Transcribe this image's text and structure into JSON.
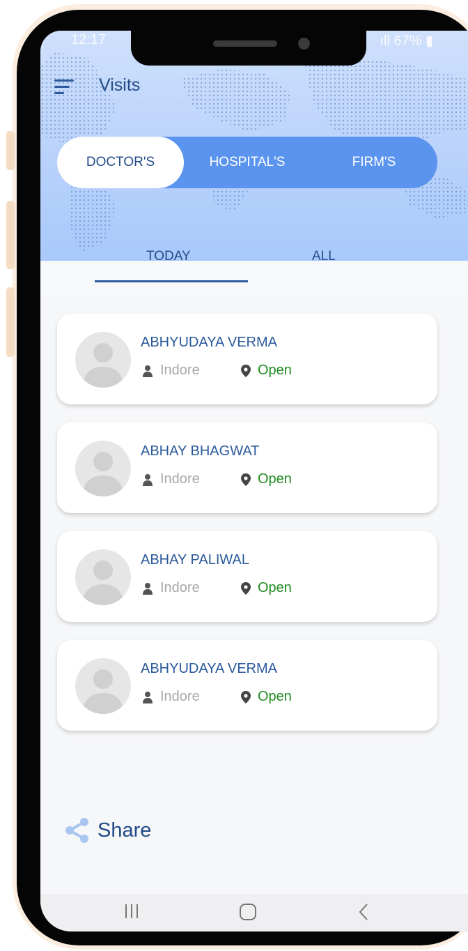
{
  "status_bar": {
    "time": "12:17",
    "battery": "67%"
  },
  "header": {
    "title": "Visits"
  },
  "segments": [
    {
      "label": "DOCTOR'S",
      "active": true
    },
    {
      "label": "HOSPITAL'S",
      "active": false
    },
    {
      "label": "FIRM'S",
      "active": false
    }
  ],
  "tabs": [
    {
      "label": "TODAY",
      "active": true
    },
    {
      "label": "ALL",
      "active": false
    }
  ],
  "visits": [
    {
      "name": "ABHYUDAYA VERMA",
      "city": "Indore",
      "status": "Open"
    },
    {
      "name": "ABHAY BHAGWAT",
      "city": "Indore",
      "status": "Open"
    },
    {
      "name": "ABHAY PALIWAL",
      "city": "Indore",
      "status": "Open"
    },
    {
      "name": "ABHYUDAYA VERMA",
      "city": "Indore",
      "status": "Open"
    }
  ],
  "share": {
    "label": "Share"
  },
  "colors": {
    "accent": "#5b94ee",
    "primary_text": "#234b87",
    "status_open": "#1f8a1f"
  },
  "icons": [
    "menu-icon",
    "user-icon",
    "location-pin-icon",
    "share-icon",
    "recents-icon",
    "home-icon",
    "back-icon"
  ]
}
